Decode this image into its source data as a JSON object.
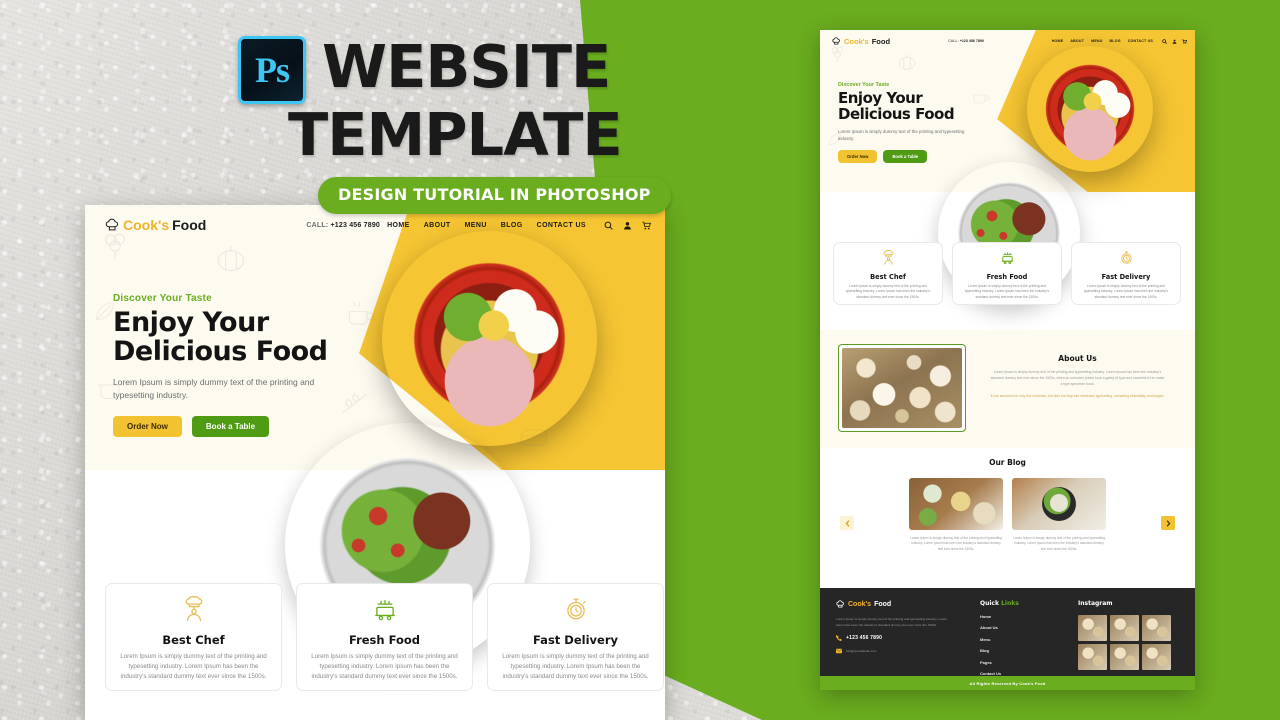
{
  "thumbnail": {
    "badge_icon": "photoshop-logo",
    "badge_text": "Ps",
    "title_line1": "WEBSITE",
    "title_line2": "TEMPLATE",
    "subtitle": "DESIGN TUTORIAL IN PHOTOSHOP",
    "accent_green": "#6aad1f",
    "accent_blue": "#3ec6f3",
    "title_color": "#1a1a1a"
  },
  "site": {
    "brand": {
      "icon": "chef-hat-icon",
      "part1": "Cook's",
      "part2": "Food"
    },
    "header": {
      "call_label": "CALL:",
      "call_number": "+123 456 7890",
      "nav": [
        "HOME",
        "ABOUT",
        "MENU",
        "BLOG",
        "CONTACT US"
      ],
      "icons": [
        "search-icon",
        "user-icon",
        "cart-icon"
      ]
    },
    "hero": {
      "eyebrow": "Discover Your Taste",
      "title_line1": "Enjoy Your",
      "title_line2": "Delicious Food",
      "paragraph": "Lorem Ipsum is simply dummy text of the printing and typesetting industry.",
      "btn_primary": "Order Now",
      "btn_secondary": "Book a Table",
      "image": "ramen-bowl-photo",
      "accent_yellow": "#f6c533",
      "bg_cream": "#fdfaf0"
    },
    "feature_cards": [
      {
        "icon": "chef-icon",
        "title": "Best Chef",
        "text": "Lorem Ipsum is simply dummy text of the printing and typesetting industry. Lorem Ipsum has been the industry's standard dummy text ever since the 1500s."
      },
      {
        "icon": "food-cart-icon",
        "title": "Fresh Food",
        "text": "Lorem Ipsum is simply dummy text of the printing and typesetting industry. Lorem Ipsum has been the industry's standard dummy text ever since the 1500s."
      },
      {
        "icon": "stopwatch-icon",
        "title": "Fast Delivery",
        "text": "Lorem Ipsum is simply dummy text of the printing and typesetting industry. Lorem Ipsum has been the industry's standard dummy text ever since the 1500s."
      }
    ],
    "salad_image": "salad-plate-photo",
    "about": {
      "title": "About Us",
      "image": "food-spread-photo",
      "paragraph": "Lorem Ipsum is simply dummy text of the printing and typesetting industry. Lorem Ipsum has been the industry's standard dummy text ever since the 1500s, when an unknown printer took a galley of type and scrambled it to make a type specimen book.",
      "paragraph_highlight": "It has survived not only five centuries, but also the leap into electronic typesetting, remaining essentially unchanged."
    },
    "blog": {
      "title": "Our Blog",
      "prev_icon": "chevron-left-icon",
      "next_icon": "chevron-right-icon",
      "posts": [
        {
          "image": "blog-photo-board",
          "text": "Lorem Ipsum is simply dummy text of the printing and typesetting industry. Lorem Ipsum has been the industry's standard dummy text ever since the 1500s."
        },
        {
          "image": "blog-photo-bowl",
          "text": "Lorem Ipsum is simply dummy text of the printing and typesetting industry. Lorem Ipsum has been the industry's standard dummy text ever since the 1500s."
        }
      ]
    },
    "footer": {
      "about_text": "Lorem Ipsum is simply dummy text of the printing and typesetting industry. Lorem Ipsum has been the industry's standard dummy text ever since the 1500s.",
      "phone_icon": "phone-icon",
      "phone": "+123 456 7890",
      "email_icon": "mail-icon",
      "email": "info@yourwebsite.com",
      "quick_links_title_1": "Quick ",
      "quick_links_title_2": "Links",
      "quick_links": [
        "Home",
        "About Us",
        "Menu",
        "Blog",
        "Pages",
        "Contact Us"
      ],
      "instagram_title": "Instagram",
      "instagram_cells": 6,
      "copyright": "All Rights Reserved By Cook's Food",
      "bg": "#262626",
      "bar": "#6aad1f"
    }
  }
}
